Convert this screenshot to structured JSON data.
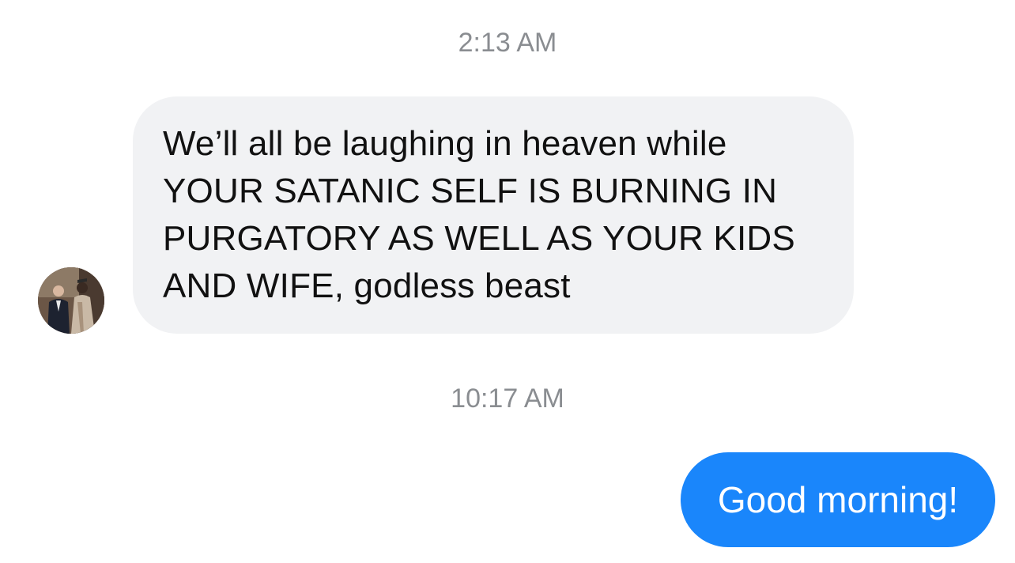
{
  "conversation": {
    "timestamps": [
      "2:13 AM",
      "10:17 AM"
    ],
    "incoming_message": {
      "lines": [
        "We’ll all be laughing in heaven while",
        "YOUR SATANIC SELF IS BURNING IN",
        "PURGATORY AS WELL AS YOUR KIDS",
        "AND WIFE, godless beast"
      ],
      "bubble_color": "#f1f2f4",
      "text_color": "#111111"
    },
    "outgoing_message": {
      "text": "Good morning!",
      "bubble_color": "#1a86fb",
      "text_color": "#ffffff"
    },
    "avatar": {
      "icon": "contact-photo-avatar"
    }
  }
}
